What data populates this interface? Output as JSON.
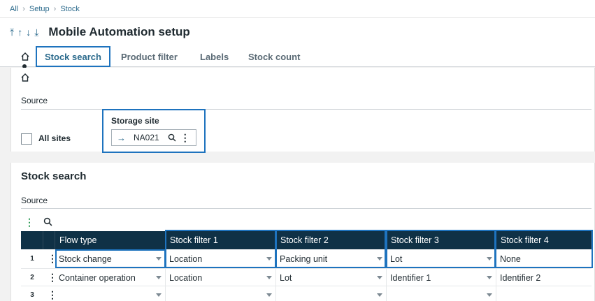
{
  "breadcrumb": [
    "All",
    "Setup",
    "Stock"
  ],
  "title": "Mobile Automation setup",
  "nav_icons": [
    "first-record-icon",
    "previous-record-icon",
    "next-record-icon",
    "last-record-icon"
  ],
  "tabs": [
    {
      "label": "Stock search",
      "active": true
    },
    {
      "label": "Product filter",
      "active": false
    },
    {
      "label": "Labels",
      "active": false
    },
    {
      "label": "Stock count",
      "active": false
    }
  ],
  "source_section": {
    "label": "Source",
    "all_sites_label": "All sites",
    "all_sites_checked": false,
    "storage_site_label": "Storage site",
    "storage_site_value": "NA021"
  },
  "stock_search": {
    "title": "Stock search",
    "source_label": "Source",
    "columns": [
      "Flow type",
      "Stock filter 1",
      "Stock filter 2",
      "Stock filter 3",
      "Stock filter 4"
    ],
    "rows": [
      {
        "num": "1",
        "cells": [
          "Stock change",
          "Location",
          "Packing unit",
          "Lot",
          "None"
        ]
      },
      {
        "num": "2",
        "cells": [
          "Container operation",
          "Location",
          "Lot",
          "Identifier 1",
          "Identifier 2"
        ]
      },
      {
        "num": "3",
        "cells": [
          "",
          "",
          "",
          "",
          ""
        ]
      }
    ]
  },
  "colors": {
    "accent": "#1e73be",
    "header_bg": "#0f3146",
    "link": "#2b6a8c"
  }
}
